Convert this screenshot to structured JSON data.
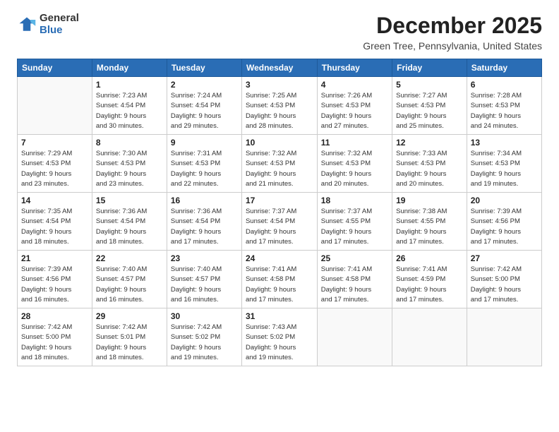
{
  "logo": {
    "general": "General",
    "blue": "Blue"
  },
  "header": {
    "title": "December 2025",
    "subtitle": "Green Tree, Pennsylvania, United States"
  },
  "weekdays": [
    "Sunday",
    "Monday",
    "Tuesday",
    "Wednesday",
    "Thursday",
    "Friday",
    "Saturday"
  ],
  "weeks": [
    [
      {
        "day": "",
        "info": ""
      },
      {
        "day": "1",
        "info": "Sunrise: 7:23 AM\nSunset: 4:54 PM\nDaylight: 9 hours\nand 30 minutes."
      },
      {
        "day": "2",
        "info": "Sunrise: 7:24 AM\nSunset: 4:54 PM\nDaylight: 9 hours\nand 29 minutes."
      },
      {
        "day": "3",
        "info": "Sunrise: 7:25 AM\nSunset: 4:53 PM\nDaylight: 9 hours\nand 28 minutes."
      },
      {
        "day": "4",
        "info": "Sunrise: 7:26 AM\nSunset: 4:53 PM\nDaylight: 9 hours\nand 27 minutes."
      },
      {
        "day": "5",
        "info": "Sunrise: 7:27 AM\nSunset: 4:53 PM\nDaylight: 9 hours\nand 25 minutes."
      },
      {
        "day": "6",
        "info": "Sunrise: 7:28 AM\nSunset: 4:53 PM\nDaylight: 9 hours\nand 24 minutes."
      }
    ],
    [
      {
        "day": "7",
        "info": "Sunrise: 7:29 AM\nSunset: 4:53 PM\nDaylight: 9 hours\nand 23 minutes."
      },
      {
        "day": "8",
        "info": "Sunrise: 7:30 AM\nSunset: 4:53 PM\nDaylight: 9 hours\nand 23 minutes."
      },
      {
        "day": "9",
        "info": "Sunrise: 7:31 AM\nSunset: 4:53 PM\nDaylight: 9 hours\nand 22 minutes."
      },
      {
        "day": "10",
        "info": "Sunrise: 7:32 AM\nSunset: 4:53 PM\nDaylight: 9 hours\nand 21 minutes."
      },
      {
        "day": "11",
        "info": "Sunrise: 7:32 AM\nSunset: 4:53 PM\nDaylight: 9 hours\nand 20 minutes."
      },
      {
        "day": "12",
        "info": "Sunrise: 7:33 AM\nSunset: 4:53 PM\nDaylight: 9 hours\nand 20 minutes."
      },
      {
        "day": "13",
        "info": "Sunrise: 7:34 AM\nSunset: 4:53 PM\nDaylight: 9 hours\nand 19 minutes."
      }
    ],
    [
      {
        "day": "14",
        "info": "Sunrise: 7:35 AM\nSunset: 4:54 PM\nDaylight: 9 hours\nand 18 minutes."
      },
      {
        "day": "15",
        "info": "Sunrise: 7:36 AM\nSunset: 4:54 PM\nDaylight: 9 hours\nand 18 minutes."
      },
      {
        "day": "16",
        "info": "Sunrise: 7:36 AM\nSunset: 4:54 PM\nDaylight: 9 hours\nand 17 minutes."
      },
      {
        "day": "17",
        "info": "Sunrise: 7:37 AM\nSunset: 4:54 PM\nDaylight: 9 hours\nand 17 minutes."
      },
      {
        "day": "18",
        "info": "Sunrise: 7:37 AM\nSunset: 4:55 PM\nDaylight: 9 hours\nand 17 minutes."
      },
      {
        "day": "19",
        "info": "Sunrise: 7:38 AM\nSunset: 4:55 PM\nDaylight: 9 hours\nand 17 minutes."
      },
      {
        "day": "20",
        "info": "Sunrise: 7:39 AM\nSunset: 4:56 PM\nDaylight: 9 hours\nand 17 minutes."
      }
    ],
    [
      {
        "day": "21",
        "info": "Sunrise: 7:39 AM\nSunset: 4:56 PM\nDaylight: 9 hours\nand 16 minutes."
      },
      {
        "day": "22",
        "info": "Sunrise: 7:40 AM\nSunset: 4:57 PM\nDaylight: 9 hours\nand 16 minutes."
      },
      {
        "day": "23",
        "info": "Sunrise: 7:40 AM\nSunset: 4:57 PM\nDaylight: 9 hours\nand 16 minutes."
      },
      {
        "day": "24",
        "info": "Sunrise: 7:41 AM\nSunset: 4:58 PM\nDaylight: 9 hours\nand 17 minutes."
      },
      {
        "day": "25",
        "info": "Sunrise: 7:41 AM\nSunset: 4:58 PM\nDaylight: 9 hours\nand 17 minutes."
      },
      {
        "day": "26",
        "info": "Sunrise: 7:41 AM\nSunset: 4:59 PM\nDaylight: 9 hours\nand 17 minutes."
      },
      {
        "day": "27",
        "info": "Sunrise: 7:42 AM\nSunset: 5:00 PM\nDaylight: 9 hours\nand 17 minutes."
      }
    ],
    [
      {
        "day": "28",
        "info": "Sunrise: 7:42 AM\nSunset: 5:00 PM\nDaylight: 9 hours\nand 18 minutes."
      },
      {
        "day": "29",
        "info": "Sunrise: 7:42 AM\nSunset: 5:01 PM\nDaylight: 9 hours\nand 18 minutes."
      },
      {
        "day": "30",
        "info": "Sunrise: 7:42 AM\nSunset: 5:02 PM\nDaylight: 9 hours\nand 19 minutes."
      },
      {
        "day": "31",
        "info": "Sunrise: 7:43 AM\nSunset: 5:02 PM\nDaylight: 9 hours\nand 19 minutes."
      },
      {
        "day": "",
        "info": ""
      },
      {
        "day": "",
        "info": ""
      },
      {
        "day": "",
        "info": ""
      }
    ]
  ]
}
